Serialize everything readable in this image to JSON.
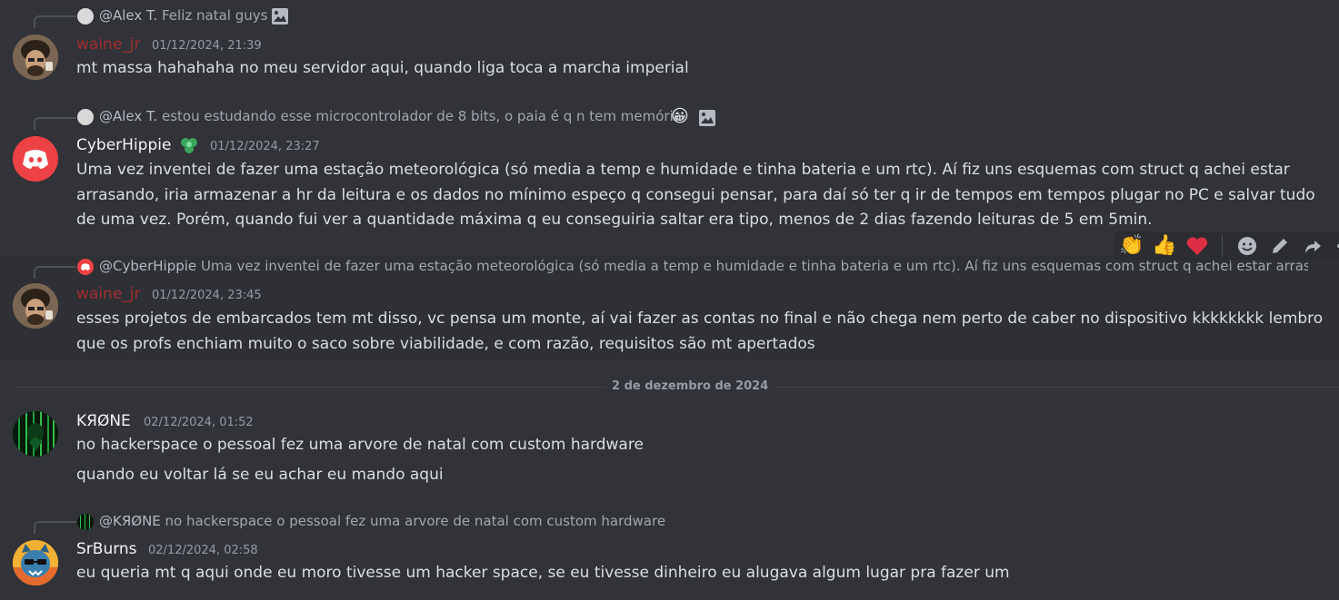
{
  "messages": [
    {
      "reply": {
        "name": "@Alex T.",
        "text": "Feliz natal guys"
      },
      "author": "waine_jr",
      "author_color": "#a12d2f",
      "timestamp": "01/12/2024, 21:39",
      "lines": [
        "mt massa hahahaha no meu servidor aqui, quando liga toca a marcha imperial"
      ]
    },
    {
      "reply": {
        "name": "@Alex T.",
        "text": "estou estudando esse microcontrolador de 8 bits, o paia é q n tem memória"
      },
      "author": "CyberHippie",
      "author_color": "#f2f3f5",
      "timestamp": "01/12/2024, 23:27",
      "lines": [
        "Uma vez inventei de fazer uma estação meteorológica (só media a temp e humidade e tinha bateria e um rtc). Aí fiz uns esquemas com struct q achei estar",
        "arrasando, iria armazenar a hr da leitura e os dados no mínimo espeço q consegui pensar, para daí só ter q ir de tempos em tempos plugar no PC e salvar tudo",
        "de uma vez. Porém, quando fui ver a quantidade máxima q eu conseguiria saltar era tipo, menos de 2 dias fazendo leituras de 5 em 5min."
      ]
    },
    {
      "reply": {
        "name": "@CyberHippie",
        "text": "Uma vez inventei de fazer uma estação meteorológica (só media a temp e humidade e tinha bateria e um rtc). Aí fiz uns esquemas com struct q achei estar arrasan..."
      },
      "author": "waine_jr",
      "author_color": "#a12d2f",
      "timestamp": "01/12/2024, 23:45",
      "lines": [
        "esses projetos de embarcados tem mt disso, vc pensa um monte, aí vai fazer as contas no final e não chega nem perto de caber no dispositivo kkkkkkkk lembro",
        "que os profs enchiam muito o saco sobre viabilidade, e com razão, requisitos são mt apertados"
      ]
    },
    {
      "author": "KЯØNE",
      "author_color": "#f2f3f5",
      "timestamp": "02/12/2024, 01:52",
      "lines": [
        "no hackerspace o pessoal fez uma arvore de natal com custom hardware"
      ],
      "followup": "quando eu voltar lá se eu achar eu mando aqui"
    },
    {
      "reply": {
        "name": "@KЯØNE",
        "text": "no hackerspace o pessoal fez uma arvore de natal com custom hardware"
      },
      "author": "SrBurns",
      "author_color": "#f2f3f5",
      "timestamp": "02/12/2024, 02:58",
      "lines": [
        "eu queria mt q aqui onde eu moro tivesse um hacker space, se eu tivesse dinheiro eu alugava algum lugar pra fazer um"
      ]
    }
  ],
  "date_divider": "2 de dezembro de 2024",
  "toolbar": {
    "reactions": [
      "👏",
      "👍",
      "❤️"
    ],
    "actions": [
      "add-reaction",
      "edit",
      "reply",
      "more"
    ]
  },
  "icons": {
    "image": "image-icon",
    "grin": "😀",
    "badge": "green-leaf-badge"
  },
  "colors": {
    "background": "#313338",
    "hover": "#2e3035",
    "discord_red": "#ed4245",
    "muted": "#949ba4"
  }
}
